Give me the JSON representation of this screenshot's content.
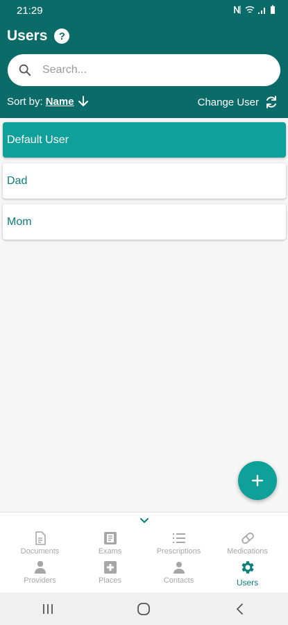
{
  "status_bar": {
    "time": "21:29"
  },
  "header": {
    "title": "Users",
    "search": {
      "placeholder": "Search...",
      "value": ""
    },
    "sort": {
      "label": "Sort by:",
      "value": "Name"
    },
    "change_user_label": "Change User"
  },
  "users": [
    {
      "name": "Default User",
      "selected": true
    },
    {
      "name": "Dad",
      "selected": false
    },
    {
      "name": "Mom",
      "selected": false
    }
  ],
  "bottom_nav": {
    "items": [
      {
        "label": "Documents",
        "icon": "document-icon"
      },
      {
        "label": "Exams",
        "icon": "exam-icon"
      },
      {
        "label": "Prescriptions",
        "icon": "list-icon"
      },
      {
        "label": "Medications",
        "icon": "pill-icon"
      },
      {
        "label": "Providers",
        "icon": "doctor-icon"
      },
      {
        "label": "Places",
        "icon": "hospital-icon"
      },
      {
        "label": "Contacts",
        "icon": "person-icon"
      },
      {
        "label": "Users",
        "icon": "gear-icon",
        "active": true
      }
    ]
  },
  "colors": {
    "header": "#0b6b68",
    "accent": "#10a09a",
    "text_accent": "#0b7f7b"
  }
}
